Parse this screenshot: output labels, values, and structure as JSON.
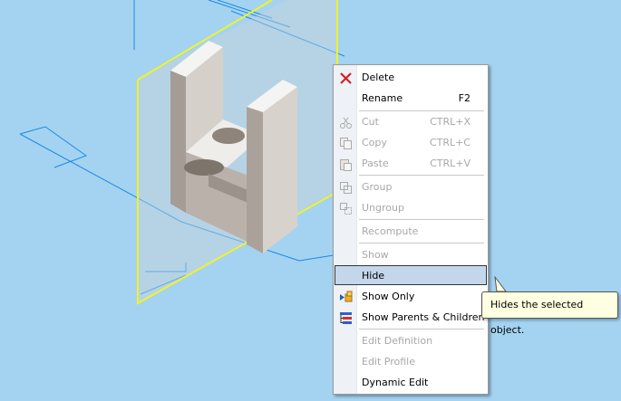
{
  "colors": {
    "viewport_background": "#a4d3f1",
    "plane_outline": "#f2f22a",
    "axis_lines": "#1a8ae6",
    "menu_highlight": "#c4d6ea",
    "tooltip_background": "#ffffe1",
    "delete_icon": "#d42020"
  },
  "menu": {
    "items": [
      {
        "label": "Delete",
        "shortcut": "",
        "icon": "delete-x-icon",
        "enabled": true
      },
      {
        "label": "Rename",
        "shortcut": "F2",
        "icon": "",
        "enabled": true
      },
      {
        "label": "Cut",
        "shortcut": "CTRL+X",
        "icon": "scissors-icon",
        "enabled": false
      },
      {
        "label": "Copy",
        "shortcut": "CTRL+C",
        "icon": "copy-icon",
        "enabled": false
      },
      {
        "label": "Paste",
        "shortcut": "CTRL+V",
        "icon": "paste-icon",
        "enabled": false
      },
      {
        "label": "Group",
        "shortcut": "",
        "icon": "group-icon",
        "enabled": false
      },
      {
        "label": "Ungroup",
        "shortcut": "",
        "icon": "ungroup-icon",
        "enabled": false
      },
      {
        "label": "Recompute",
        "shortcut": "",
        "icon": "",
        "enabled": false
      },
      {
        "label": "Show",
        "shortcut": "",
        "icon": "",
        "enabled": false
      },
      {
        "label": "Hide",
        "shortcut": "",
        "icon": "",
        "enabled": true,
        "highlighted": true
      },
      {
        "label": "Show Only",
        "shortcut": "",
        "icon": "show-only-icon",
        "enabled": true
      },
      {
        "label": "Show Parents & Children",
        "shortcut": "",
        "icon": "parents-children-icon",
        "enabled": true
      },
      {
        "label": "Edit Definition",
        "shortcut": "",
        "icon": "",
        "enabled": false
      },
      {
        "label": "Edit Profile",
        "shortcut": "",
        "icon": "",
        "enabled": false
      },
      {
        "label": "Dynamic Edit",
        "shortcut": "",
        "icon": "",
        "enabled": true
      }
    ]
  },
  "tooltip": {
    "text": "Hides the selected object."
  }
}
